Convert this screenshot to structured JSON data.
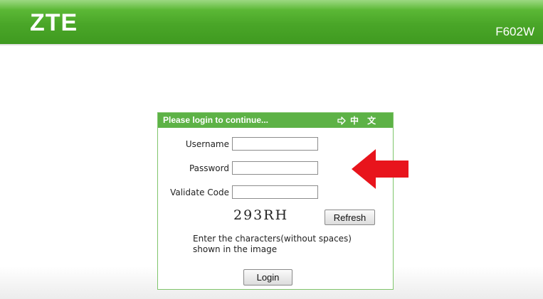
{
  "header": {
    "logo": "ZTE",
    "model": "F602W"
  },
  "login": {
    "title": "Please login to continue...",
    "language_switch": "中 文",
    "username_label": "Username",
    "password_label": "Password",
    "validate_label": "Validate Code",
    "captcha_text": "293RH",
    "refresh_label": "Refresh",
    "hint_line1": "Enter the characters(without spaces)",
    "hint_line2": "shown in the image",
    "login_label": "Login"
  },
  "colors": {
    "brand_green": "#4aa628",
    "box_header_green": "#5db246",
    "arrow_red": "#e8141c"
  },
  "icons": {
    "language_icon": "arrow-right-outline-icon",
    "annotation": "red-arrow-left-icon"
  }
}
